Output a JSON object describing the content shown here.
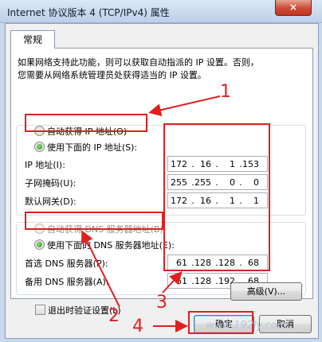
{
  "window": {
    "title": "Internet 协议版本 4 (TCP/IPv4) 属性",
    "close_label": "×"
  },
  "tabs": [
    "常规"
  ],
  "description": [
    "如果网络支持此功能，则可以获取自动指派的 IP 设置。否则，",
    "您需要从网络系统管理员处获得适当的 IP 设置。"
  ],
  "ip_section": {
    "auto_label": "自动获得 IP 地址(O)",
    "manual_label": "使用下面的 IP 地址(S):",
    "selected": "manual",
    "fields": [
      {
        "label": "IP 地址(I):",
        "octets": [
          "172",
          "16",
          "1",
          "153"
        ]
      },
      {
        "label": "子网掩码(U):",
        "octets": [
          "255",
          "255",
          "0",
          "0"
        ]
      },
      {
        "label": "默认网关(D):",
        "octets": [
          "172",
          "16",
          "1",
          "1"
        ]
      }
    ]
  },
  "dns_section": {
    "auto_label": "自动获得 DNS 服务器地址(B)",
    "manual_label": "使用下面的 DNS 服务器地址(E):",
    "selected": "manual",
    "fields": [
      {
        "label": "首选 DNS 服务器(P):",
        "octets": [
          "61",
          "128",
          "128",
          "68"
        ]
      },
      {
        "label": "备用 DNS 服务器(A):",
        "octets": [
          "61",
          "128",
          "192",
          "68"
        ]
      }
    ]
  },
  "validate_label": "退出时验证设置(L)",
  "advanced_label": "高级(V)...",
  "ok_label": "确定",
  "cancel_label": "取消",
  "annotations": [
    "1",
    "2",
    "3",
    "4"
  ],
  "watermark": "www.192ly.com",
  "colors": {
    "annotation": "#e02020",
    "accent": "#3c7fb1"
  }
}
